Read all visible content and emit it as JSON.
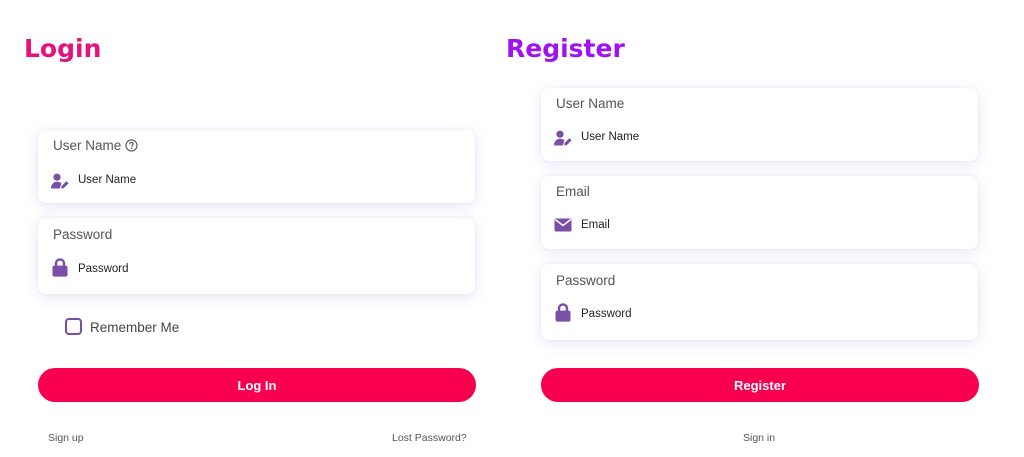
{
  "login": {
    "title": "Login",
    "username": {
      "label": "User Name",
      "value": "User Name",
      "icon": "user-edit-icon",
      "help_icon": "question-circle-icon"
    },
    "password": {
      "label": "Password",
      "value": "Password",
      "icon": "lock-icon"
    },
    "remember_me": {
      "label": "Remember Me",
      "checked": false
    },
    "submit_label": "Log In",
    "sign_up_link": "Sign up",
    "lost_password_link": "Lost Password?"
  },
  "register": {
    "title": "Register",
    "username": {
      "label": "User Name",
      "value": "User Name",
      "icon": "user-edit-icon"
    },
    "email": {
      "label": "Email",
      "value": "Email",
      "icon": "envelope-icon"
    },
    "password": {
      "label": "Password",
      "value": "Password",
      "icon": "lock-icon"
    },
    "submit_label": "Register",
    "sign_in_link": "Sign in"
  },
  "colors": {
    "login_title": "#e8107c",
    "register_title": "#a112f2",
    "button": "#f8004f",
    "icon": "#7a4fa8"
  }
}
